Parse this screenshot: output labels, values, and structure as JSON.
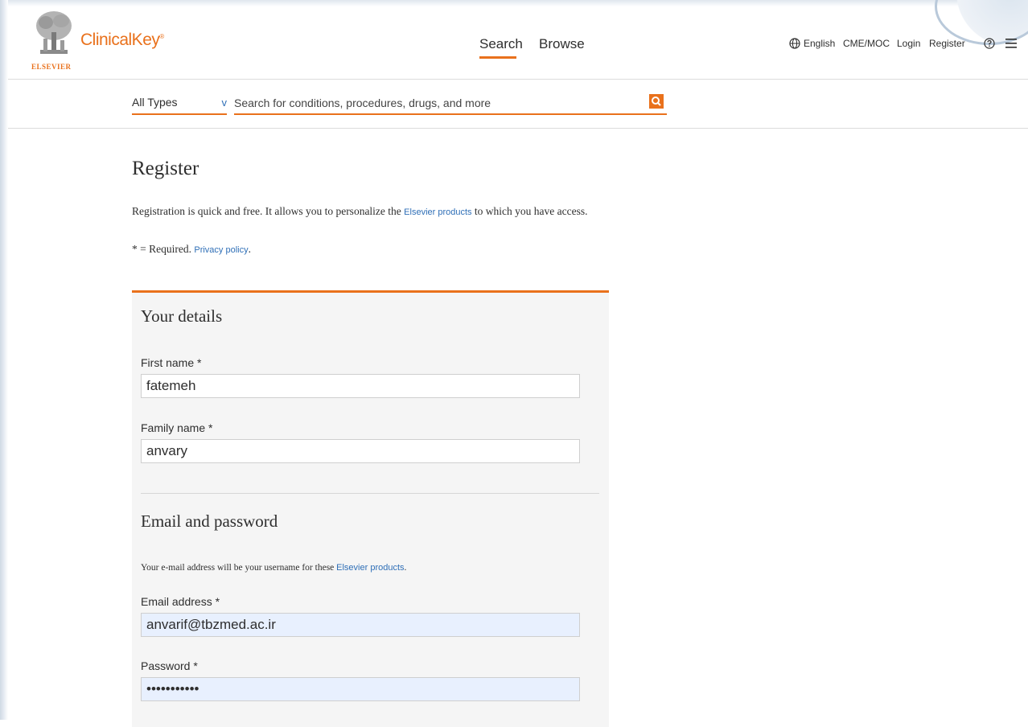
{
  "brand": {
    "publisher": "ELSEVIER",
    "product": "ClinicalKey",
    "trademark": "®",
    "accent_color": "#e9711c"
  },
  "nav": {
    "search": "Search",
    "browse": "Browse"
  },
  "utility": {
    "language": "English",
    "cme": "CME/MOC",
    "login": "Login",
    "register": "Register",
    "icons": [
      "globe-icon",
      "help-icon",
      "menu-icon"
    ]
  },
  "searchbar": {
    "type_selected": "All Types",
    "chevron": "v",
    "placeholder": "Search for conditions, procedures, drugs, and more",
    "button_icon": "search-icon"
  },
  "page": {
    "title": "Register",
    "intro_prefix": "Registration is quick and free. It allows you to personalize the",
    "intro_link": "Elsevier products",
    "intro_suffix": "to which you have access.",
    "required_prefix": "* = Required.",
    "privacy_link": "Privacy policy",
    "required_suffix": "."
  },
  "form": {
    "details": {
      "title": "Your details",
      "first_name_label": "First name *",
      "first_name_value": "fatemeh",
      "family_name_label": "Family name *",
      "family_name_value": "anvary"
    },
    "credentials": {
      "title": "Email and password",
      "note_prefix": "Your e-mail address will be your username for these",
      "note_link": "Elsevier products",
      "note_suffix": ".",
      "email_label": "Email address *",
      "email_value": "anvarif@tbzmed.ac.ir",
      "password_label": "Password *",
      "password_value": "anvarifatem"
    }
  }
}
